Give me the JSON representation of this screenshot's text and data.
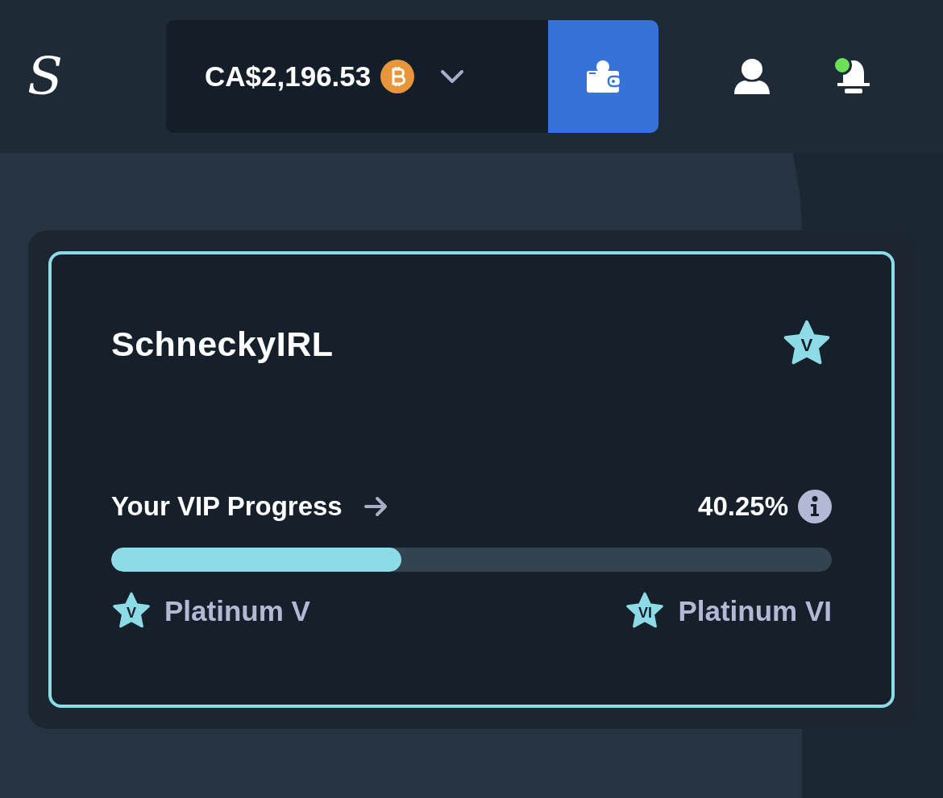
{
  "header": {
    "logo": "S",
    "balance": "CA$2,196.53",
    "notifications": {
      "unread": true
    }
  },
  "vip_card": {
    "username": "SchneckyIRL",
    "tier_badge": "V",
    "progress_label": "Your VIP Progress",
    "progress_percent": "40.25%",
    "progress": {
      "level": 0.4025
    },
    "current_tier": {
      "badge": "V",
      "name": "Platinum V"
    },
    "next_tier": {
      "badge": "VI",
      "name": "Platinum VI"
    }
  }
}
